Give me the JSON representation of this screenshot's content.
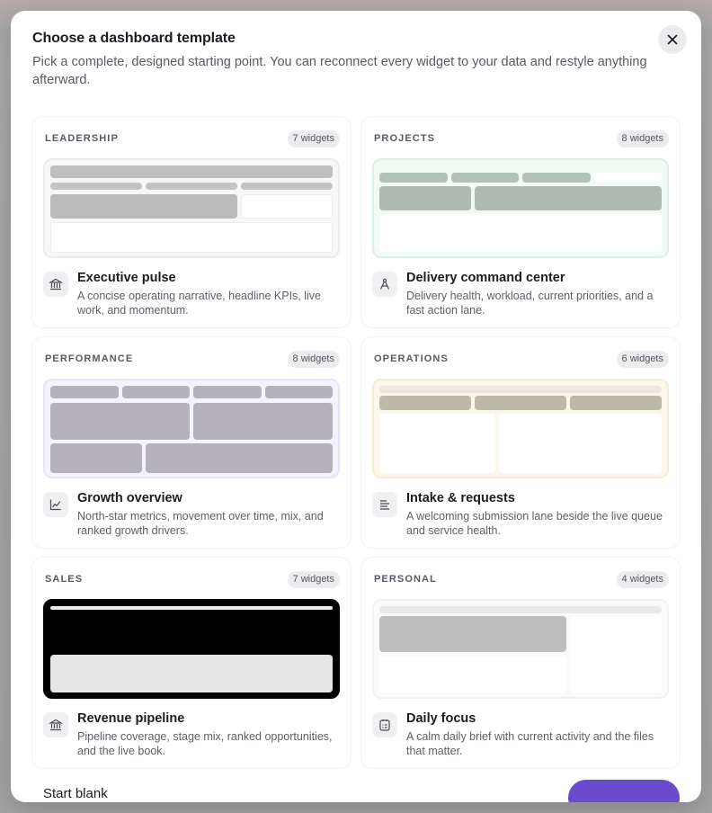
{
  "modal": {
    "title": "Choose a dashboard template",
    "subtitle": "Pick a complete, designed starting point. You can reconnect every widget to your data and restyle anything afterward."
  },
  "templates": [
    {
      "category": "LEADERSHIP",
      "badge": "7 widgets",
      "title": "Executive pulse",
      "description": "A concise operating narrative, headline KPIs, live work, and momentum.",
      "icon": "bank-icon",
      "accent": "#ececef"
    },
    {
      "category": "PROJECTS",
      "badge": "8 widgets",
      "title": "Delivery command center",
      "description": "Delivery health, workload, current priorities, and a fast action lane.",
      "icon": "compass-icon",
      "accent": "#dcefe6"
    },
    {
      "category": "PERFORMANCE",
      "badge": "8 widgets",
      "title": "Growth overview",
      "description": "North-star metrics, movement over time, mix, and ranked growth drivers.",
      "icon": "line-chart-icon",
      "accent": "#e7e3f8"
    },
    {
      "category": "OPERATIONS",
      "badge": "6 widgets",
      "title": "Intake & requests",
      "description": "A welcoming submission lane beside the live queue and service health.",
      "icon": "queue-icon",
      "accent": "#f5ecd5"
    },
    {
      "category": "SALES",
      "badge": "7 widgets",
      "title": "Revenue pipeline",
      "description": "Pipeline coverage, stage mix, ranked opportunities, and the live book.",
      "icon": "bank-icon",
      "accent": "#000000"
    },
    {
      "category": "PERSONAL",
      "badge": "4 widgets",
      "title": "Daily focus",
      "description": "A calm daily brief with current activity and the files that matter.",
      "icon": "planner-icon",
      "accent": "#ececef"
    }
  ],
  "footer": {
    "start_blank": "Start blank",
    "primary_button": ""
  },
  "colors": {
    "primary": "#6a4bd0"
  }
}
